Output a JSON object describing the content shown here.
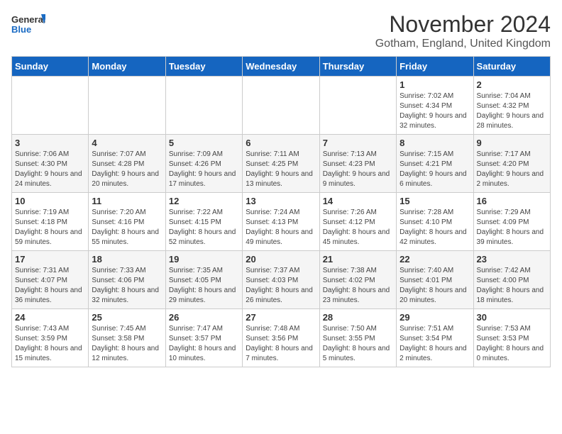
{
  "logo": {
    "line1": "General",
    "line2": "Blue"
  },
  "title": "November 2024",
  "location": "Gotham, England, United Kingdom",
  "days_of_week": [
    "Sunday",
    "Monday",
    "Tuesday",
    "Wednesday",
    "Thursday",
    "Friday",
    "Saturday"
  ],
  "weeks": [
    [
      {
        "day": "",
        "info": ""
      },
      {
        "day": "",
        "info": ""
      },
      {
        "day": "",
        "info": ""
      },
      {
        "day": "",
        "info": ""
      },
      {
        "day": "",
        "info": ""
      },
      {
        "day": "1",
        "info": "Sunrise: 7:02 AM\nSunset: 4:34 PM\nDaylight: 9 hours and 32 minutes."
      },
      {
        "day": "2",
        "info": "Sunrise: 7:04 AM\nSunset: 4:32 PM\nDaylight: 9 hours and 28 minutes."
      }
    ],
    [
      {
        "day": "3",
        "info": "Sunrise: 7:06 AM\nSunset: 4:30 PM\nDaylight: 9 hours and 24 minutes."
      },
      {
        "day": "4",
        "info": "Sunrise: 7:07 AM\nSunset: 4:28 PM\nDaylight: 9 hours and 20 minutes."
      },
      {
        "day": "5",
        "info": "Sunrise: 7:09 AM\nSunset: 4:26 PM\nDaylight: 9 hours and 17 minutes."
      },
      {
        "day": "6",
        "info": "Sunrise: 7:11 AM\nSunset: 4:25 PM\nDaylight: 9 hours and 13 minutes."
      },
      {
        "day": "7",
        "info": "Sunrise: 7:13 AM\nSunset: 4:23 PM\nDaylight: 9 hours and 9 minutes."
      },
      {
        "day": "8",
        "info": "Sunrise: 7:15 AM\nSunset: 4:21 PM\nDaylight: 9 hours and 6 minutes."
      },
      {
        "day": "9",
        "info": "Sunrise: 7:17 AM\nSunset: 4:20 PM\nDaylight: 9 hours and 2 minutes."
      }
    ],
    [
      {
        "day": "10",
        "info": "Sunrise: 7:19 AM\nSunset: 4:18 PM\nDaylight: 8 hours and 59 minutes."
      },
      {
        "day": "11",
        "info": "Sunrise: 7:20 AM\nSunset: 4:16 PM\nDaylight: 8 hours and 55 minutes."
      },
      {
        "day": "12",
        "info": "Sunrise: 7:22 AM\nSunset: 4:15 PM\nDaylight: 8 hours and 52 minutes."
      },
      {
        "day": "13",
        "info": "Sunrise: 7:24 AM\nSunset: 4:13 PM\nDaylight: 8 hours and 49 minutes."
      },
      {
        "day": "14",
        "info": "Sunrise: 7:26 AM\nSunset: 4:12 PM\nDaylight: 8 hours and 45 minutes."
      },
      {
        "day": "15",
        "info": "Sunrise: 7:28 AM\nSunset: 4:10 PM\nDaylight: 8 hours and 42 minutes."
      },
      {
        "day": "16",
        "info": "Sunrise: 7:29 AM\nSunset: 4:09 PM\nDaylight: 8 hours and 39 minutes."
      }
    ],
    [
      {
        "day": "17",
        "info": "Sunrise: 7:31 AM\nSunset: 4:07 PM\nDaylight: 8 hours and 36 minutes."
      },
      {
        "day": "18",
        "info": "Sunrise: 7:33 AM\nSunset: 4:06 PM\nDaylight: 8 hours and 32 minutes."
      },
      {
        "day": "19",
        "info": "Sunrise: 7:35 AM\nSunset: 4:05 PM\nDaylight: 8 hours and 29 minutes."
      },
      {
        "day": "20",
        "info": "Sunrise: 7:37 AM\nSunset: 4:03 PM\nDaylight: 8 hours and 26 minutes."
      },
      {
        "day": "21",
        "info": "Sunrise: 7:38 AM\nSunset: 4:02 PM\nDaylight: 8 hours and 23 minutes."
      },
      {
        "day": "22",
        "info": "Sunrise: 7:40 AM\nSunset: 4:01 PM\nDaylight: 8 hours and 20 minutes."
      },
      {
        "day": "23",
        "info": "Sunrise: 7:42 AM\nSunset: 4:00 PM\nDaylight: 8 hours and 18 minutes."
      }
    ],
    [
      {
        "day": "24",
        "info": "Sunrise: 7:43 AM\nSunset: 3:59 PM\nDaylight: 8 hours and 15 minutes."
      },
      {
        "day": "25",
        "info": "Sunrise: 7:45 AM\nSunset: 3:58 PM\nDaylight: 8 hours and 12 minutes."
      },
      {
        "day": "26",
        "info": "Sunrise: 7:47 AM\nSunset: 3:57 PM\nDaylight: 8 hours and 10 minutes."
      },
      {
        "day": "27",
        "info": "Sunrise: 7:48 AM\nSunset: 3:56 PM\nDaylight: 8 hours and 7 minutes."
      },
      {
        "day": "28",
        "info": "Sunrise: 7:50 AM\nSunset: 3:55 PM\nDaylight: 8 hours and 5 minutes."
      },
      {
        "day": "29",
        "info": "Sunrise: 7:51 AM\nSunset: 3:54 PM\nDaylight: 8 hours and 2 minutes."
      },
      {
        "day": "30",
        "info": "Sunrise: 7:53 AM\nSunset: 3:53 PM\nDaylight: 8 hours and 0 minutes."
      }
    ]
  ]
}
